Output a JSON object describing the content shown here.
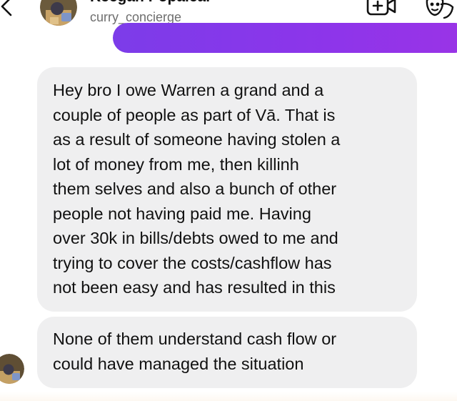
{
  "header": {
    "display_name": "Keegan Popalcal",
    "username": "curry_concierge",
    "icons": {
      "back": "chevron-left-icon",
      "video": "video-call-icon",
      "mask": "effects-mask-icon"
    }
  },
  "colors": {
    "sent_bubble": "#8a37ea",
    "received_bubble": "#efeff0",
    "text": "#111111",
    "username": "#6e6e6e"
  },
  "messages": [
    {
      "direction": "received",
      "lines": [
        "Hey bro I owe Warren a grand and a",
        "couple of people as part of Vā. That is",
        "as a result of someone having stolen a",
        "lot of money from me, then killinh",
        "them selves and also a bunch of other",
        "people not having paid me. Having",
        "over 30k in bills/debts owed to me and",
        "trying to cover the costs/cashflow has",
        "not been easy and has resulted in this"
      ]
    },
    {
      "direction": "received",
      "lines": [
        "None of them understand cash flow or",
        "could have managed the situation"
      ]
    }
  ]
}
